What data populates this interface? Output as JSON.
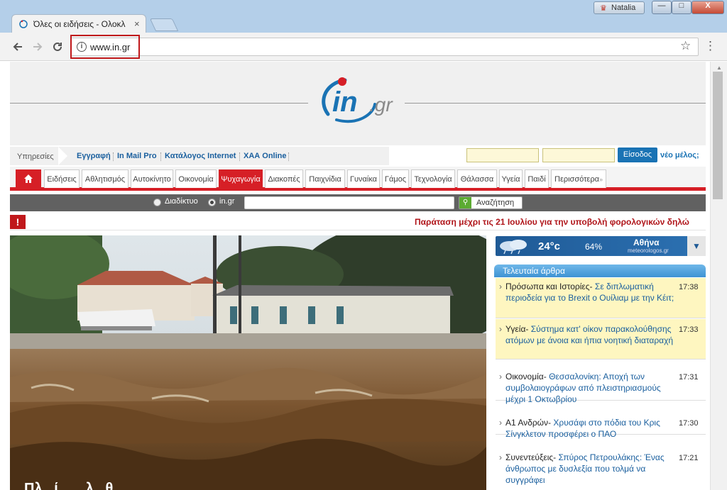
{
  "browser": {
    "tab_title": "Όλες οι ειδήσεις - Ολοκλ",
    "tab_close": "×",
    "user_name": "Natalia",
    "url": "www.in.gr",
    "back_icon": "arrow-left-icon",
    "forward_icon": "arrow-right-icon",
    "reload_icon": "reload-icon",
    "info_icon": "i",
    "star_icon": "☆",
    "menu_icon": "⋮",
    "win_min": "—",
    "win_max": "□",
    "win_close": "X"
  },
  "site": {
    "logo_in": "in",
    "logo_gr": ".gr",
    "brand_color": "#1a73b4",
    "accent_color": "#d61f26"
  },
  "services": {
    "label": "Υπηρεσίες",
    "links": [
      "Εγγραφή",
      "In Mail Pro",
      "Κατάλογος Internet",
      "ΧΑΑ Online"
    ],
    "login_button": "Είσοδος",
    "new_member": "νέο μέλος;"
  },
  "menu": {
    "items": [
      "Ειδήσεις",
      "Αθλητισμός",
      "Αυτοκίνητο",
      "Οικονομία",
      "Ψυχαγωγία",
      "Διακοπές",
      "Παιχνίδια",
      "Γυναίκα",
      "Γάμος",
      "Τεχνολογία",
      "Θάλασσα",
      "Υγεία",
      "Παιδί",
      "Περισσότερα"
    ],
    "active": "Ψυχαγωγία",
    "more_caret": "»"
  },
  "search": {
    "option_web": "Διαδίκτυο",
    "option_site": "in.gr",
    "selected": "in.gr",
    "button": "Αναζήτηση"
  },
  "ticker": {
    "icon": "!",
    "text": "Παράταση μέχρι τις 21 Ιουλίου για την υποβολή φορολογικών δηλώ"
  },
  "hero": {
    "caption": "Πλ...ί...          ...λ...θ..."
  },
  "weather": {
    "temp": "24°c",
    "humidity": "64%",
    "city": "Αθήνα",
    "source": "meteorologos.gr",
    "dropdown": "▼"
  },
  "articles": {
    "header": "Τελευταία άρθρα",
    "items": [
      {
        "category": "Πρόσωπα και Ιστορίες-",
        "title": "Σε διπλωματική περιοδεία για το Brexit ο Ουίλιαμ με την Κέιτ;",
        "time": "17:38",
        "highlight": true
      },
      {
        "category": "Υγεία-",
        "title": "Σύστημα κατ' οίκον παρακολούθησης ατόμων με άνοια και ήπια νοητική διαταραχή",
        "time": "17:33",
        "highlight": true
      },
      {
        "category": "Οικονομία-",
        "title": "Θεσσαλονίκη: Αποχή των συμβολαιογράφων από πλειστηριασμούς μέχρι 1 Οκτωβρίου",
        "time": "17:31",
        "highlight": false
      },
      {
        "category": "Α1 Ανδρών-",
        "title": "Χρυσάφι στο πόδια του Κρις Σίνγκλετον προσφέρει ο ΠΑΟ",
        "time": "17:30",
        "highlight": false
      },
      {
        "category": "Συνεντεύξεις-",
        "title": "Σπύρος Πετρουλάκης: Ένας άνθρωπος με δυσλεξία που τολμά να συγγράφει",
        "time": "17:21",
        "highlight": false
      }
    ]
  }
}
